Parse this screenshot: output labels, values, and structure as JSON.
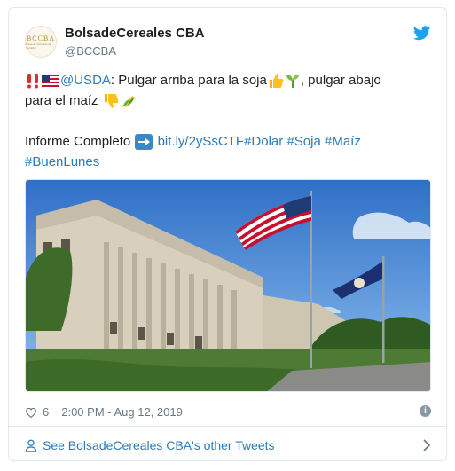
{
  "tweet": {
    "author_name": "BolsadeCereales CBA",
    "author_handle": "@BCCBA",
    "avatar_text": "BCCBA",
    "avatar_subtext": "Bolsa de Cereales de Córdoba",
    "mention": "@USDA",
    "line1_text": ": Pulgar arriba para la soja",
    "line1_tail": ", pulgar abajo",
    "line2_text": "para el maíz",
    "informe_label": "Informe Completo",
    "link": "bit.ly/2ySsCTF",
    "hashtags": [
      "#Dolar",
      "#Soja",
      "#Maíz",
      "#BuenLunes"
    ],
    "likes": "6",
    "timestamp": "2:00 PM - Aug 12, 2019",
    "footer_link": "See BolsadeCereales CBA's other Tweets"
  },
  "icons": [
    "twitter-bird-icon",
    "double-exclamation-icon",
    "us-flag-icon",
    "thumbs-up-icon",
    "seedling-icon",
    "thumbs-down-icon",
    "corn-icon",
    "right-arrow-icon",
    "heart-icon",
    "info-icon",
    "person-icon",
    "chevron-right-icon"
  ],
  "colors": {
    "link": "#2b7bb9",
    "text": "#1c2022",
    "muted": "#697882",
    "twitter_blue": "#1da1f2"
  }
}
